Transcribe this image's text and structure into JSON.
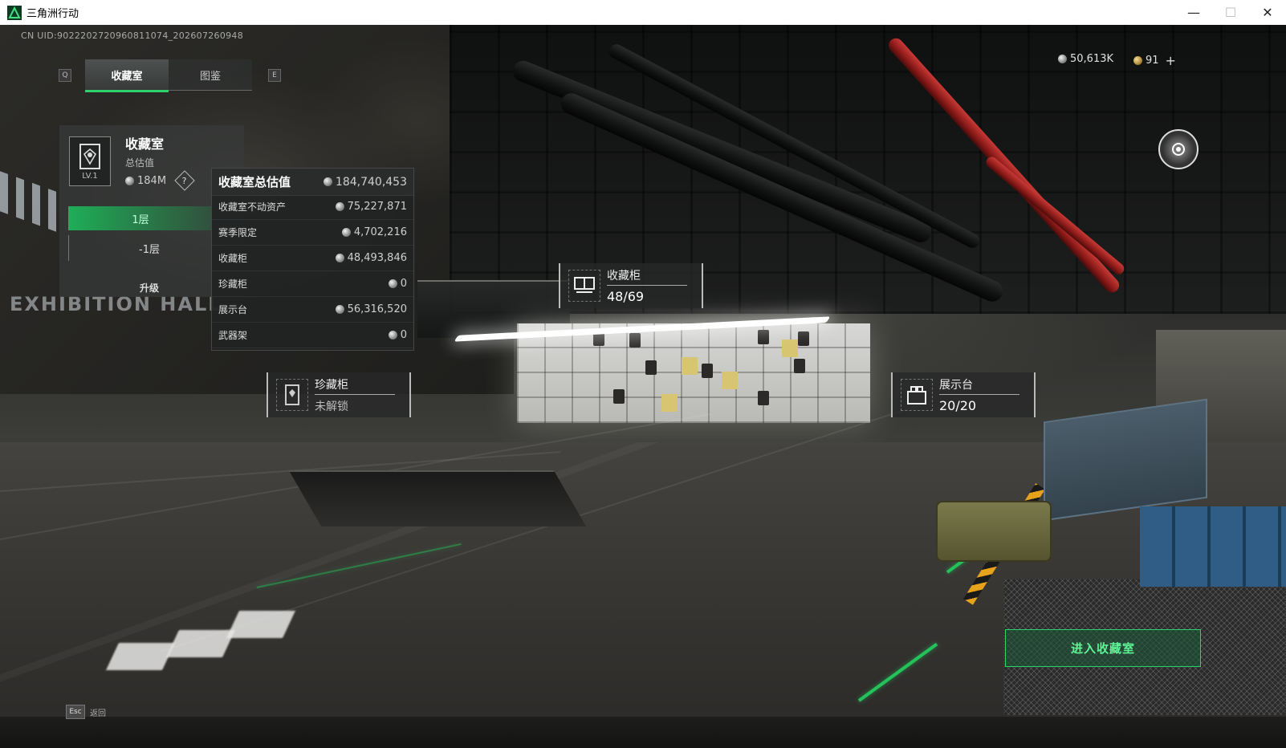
{
  "window": {
    "title": "三角洲行动",
    "controls": {
      "minimize": "—",
      "maximize": "☐",
      "close": "✕"
    }
  },
  "hud": {
    "uid": "CN UID:9022202720960811074_202607260948",
    "tab_key_left": "Q",
    "tab_key_right": "E",
    "tabs": [
      {
        "label": "收藏室",
        "active": true
      },
      {
        "label": "图鉴",
        "active": false
      }
    ],
    "currency": [
      {
        "icon": "silver-coin-icon",
        "value": "50,613K"
      },
      {
        "icon": "gold-coin-icon",
        "value": "91"
      }
    ],
    "currency_add": "+"
  },
  "room_panel": {
    "title": "收藏室",
    "level": "LV.1",
    "subtitle": "总估值",
    "value": "184M",
    "help": "?",
    "floors": [
      "1层",
      "-1层"
    ],
    "upgrade": "升级"
  },
  "value_tooltip": {
    "header": {
      "label": "收藏室总估值",
      "value": "184,740,453"
    },
    "rows": [
      {
        "label": "收藏室不动资产",
        "value": "75,227,871"
      },
      {
        "label": "赛季限定",
        "value": "4,702,216"
      },
      {
        "label": "收藏柜",
        "value": "48,493,846"
      },
      {
        "label": "珍藏柜",
        "value": "0"
      },
      {
        "label": "展示台",
        "value": "56,316,520"
      },
      {
        "label": "武器架",
        "value": "0"
      }
    ]
  },
  "world_tags": {
    "cabinet": {
      "name": "收藏柜",
      "value": "48/69"
    },
    "treasure": {
      "name": "珍藏柜",
      "value": "未解锁"
    },
    "display": {
      "name": "展示台",
      "value": "20/20"
    }
  },
  "scene": {
    "sign_text": "EXHIBITION HALL"
  },
  "enter_button": "进入收藏室",
  "back": {
    "key": "Esc",
    "label": "返回"
  },
  "colors": {
    "accent_green": "#2fd16c",
    "enter_text": "#5ef396",
    "pipe_red": "#c73a36"
  }
}
